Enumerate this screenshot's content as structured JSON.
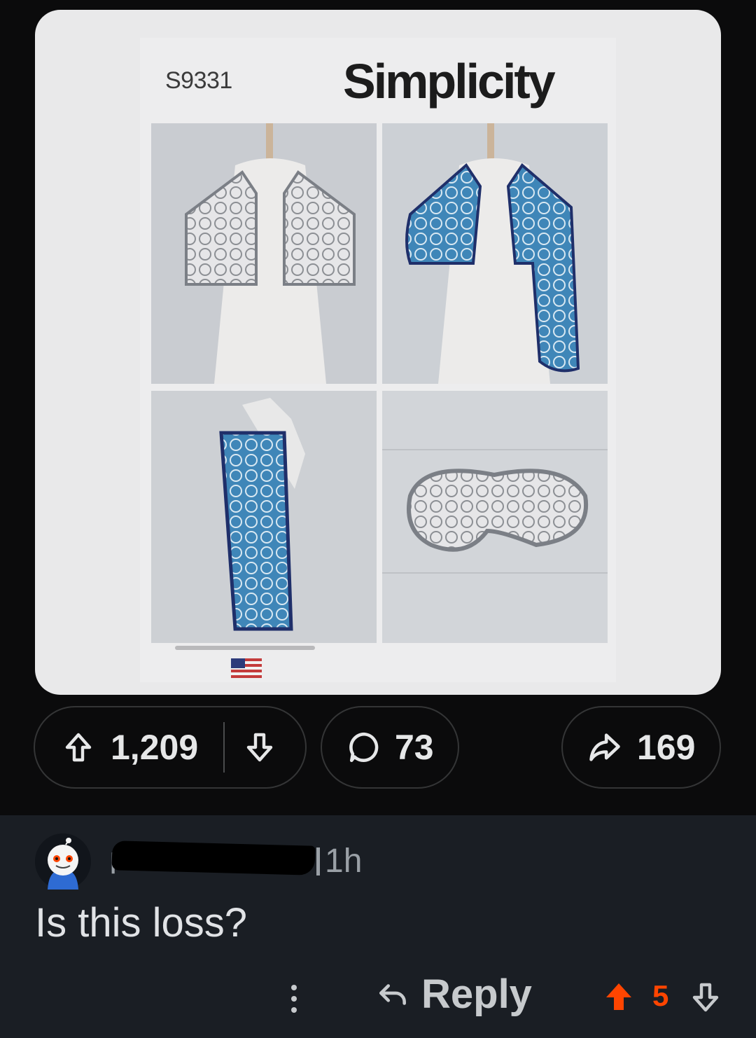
{
  "media": {
    "pattern_number": "S9331",
    "brand": "Simplicity"
  },
  "post_actions": {
    "vote_count": "1,209",
    "comment_count": "73",
    "share_count": "169"
  },
  "comment": {
    "author_initial": "F",
    "timestamp": "1h",
    "body": "Is this loss?",
    "reply_label": "Reply",
    "score": "5"
  },
  "colors": {
    "upvoted": "#ff4500",
    "background": "#0b0b0c",
    "comment_background": "#1a1e24"
  },
  "icons": [
    "upvote-icon",
    "downvote-icon",
    "comment-icon",
    "share-icon",
    "more-icon",
    "reply-icon"
  ]
}
